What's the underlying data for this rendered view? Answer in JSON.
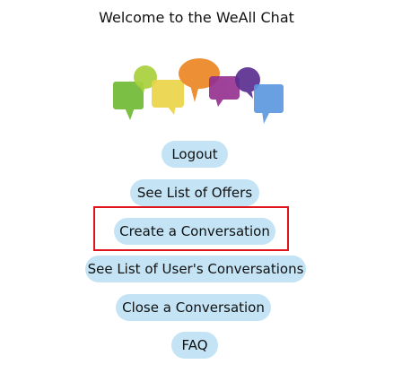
{
  "header": {
    "title": "Welcome to the WeAll Chat"
  },
  "logo": {
    "icon": "chat-bubbles-logo",
    "colors": [
      "#7cbf45",
      "#a9d13c",
      "#ead345",
      "#ec8a2b",
      "#932d8f",
      "#5b2f90",
      "#5c98df"
    ]
  },
  "menu": {
    "logout": "Logout",
    "see_offers": "See List of Offers",
    "create_conversation": "Create a Conversation",
    "see_user_conversations": "See List of User's Conversations",
    "close_conversation": "Close a Conversation",
    "faq": "FAQ"
  },
  "style": {
    "button_bg": "#c4e4f5",
    "highlight_color": "#e0141b"
  }
}
